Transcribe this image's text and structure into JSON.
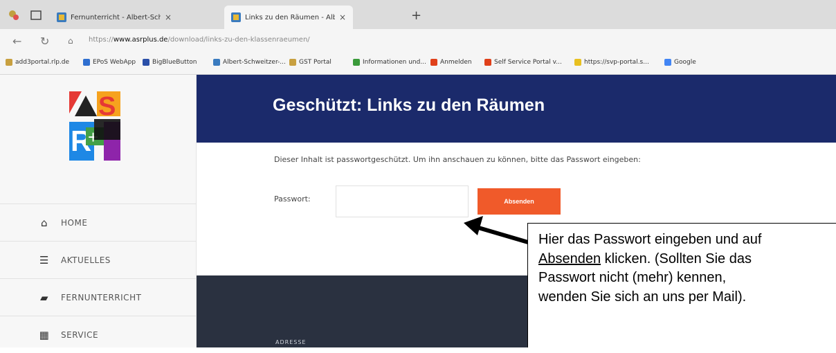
{
  "browser": {
    "tabs": [
      {
        "label": "Fernunterricht - Albert-Schweitz",
        "close": "×",
        "active": false
      },
      {
        "label": "Links zu den Räumen - Albert-S",
        "close": "×",
        "active": true
      }
    ],
    "new_tab": "+",
    "url_prefix": "https://",
    "url_host": "www.asrplus.de",
    "url_path": "/download/links-zu-den-klassenraeumen/",
    "bookmarks": [
      {
        "label": "add3portal.rlp.de",
        "color": "#c8a040"
      },
      {
        "label": "EPoS WebApp",
        "color": "#2f6fd0"
      },
      {
        "label": "BigBlueButton",
        "color": "#2a4fa8"
      },
      {
        "label": "Albert-Schweitzer-...",
        "color": "#3a7bbf"
      },
      {
        "label": "GST Portal",
        "color": "#c8a040"
      },
      {
        "label": "Informationen und...",
        "color": "#3a9a3a"
      },
      {
        "label": "Anmelden",
        "color": "#e0401a"
      },
      {
        "label": "Self Service Portal v...",
        "color": "#e0401a"
      },
      {
        "label": "https://svp-portal.s...",
        "color": "#e8c020"
      },
      {
        "label": "Google",
        "color": "#4285f4"
      }
    ]
  },
  "sidebar": {
    "items": [
      {
        "label": "HOME",
        "icon": "home-icon"
      },
      {
        "label": "AKTUELLES",
        "icon": "list-icon"
      },
      {
        "label": "FERNUNTERRICHT",
        "icon": "folder-icon"
      },
      {
        "label": "SERVICE",
        "icon": "calendar-icon"
      }
    ]
  },
  "page": {
    "title": "Geschützt: Links zu den Räumen",
    "note": "Dieser Inhalt ist passwortgeschützt. Um ihn anschauen zu können, bitte das Passwort eingeben:",
    "password_label": "Passwort:",
    "password_value": "",
    "submit_label": "Absenden",
    "footer_label": "ADRESSE"
  },
  "callout": {
    "line1": "Hier das Passwort eingeben und auf",
    "line2_link": "Absenden",
    "line2_rest": " klicken. (Sollten Sie das",
    "line3": "Passwort nicht (mehr) kennen,",
    "line4": "wenden Sie sich an uns per Mail)."
  },
  "colors": {
    "header_bg": "#1b2a6b",
    "submit_bg": "#f05a2a",
    "footer_bg": "#2a3140"
  }
}
